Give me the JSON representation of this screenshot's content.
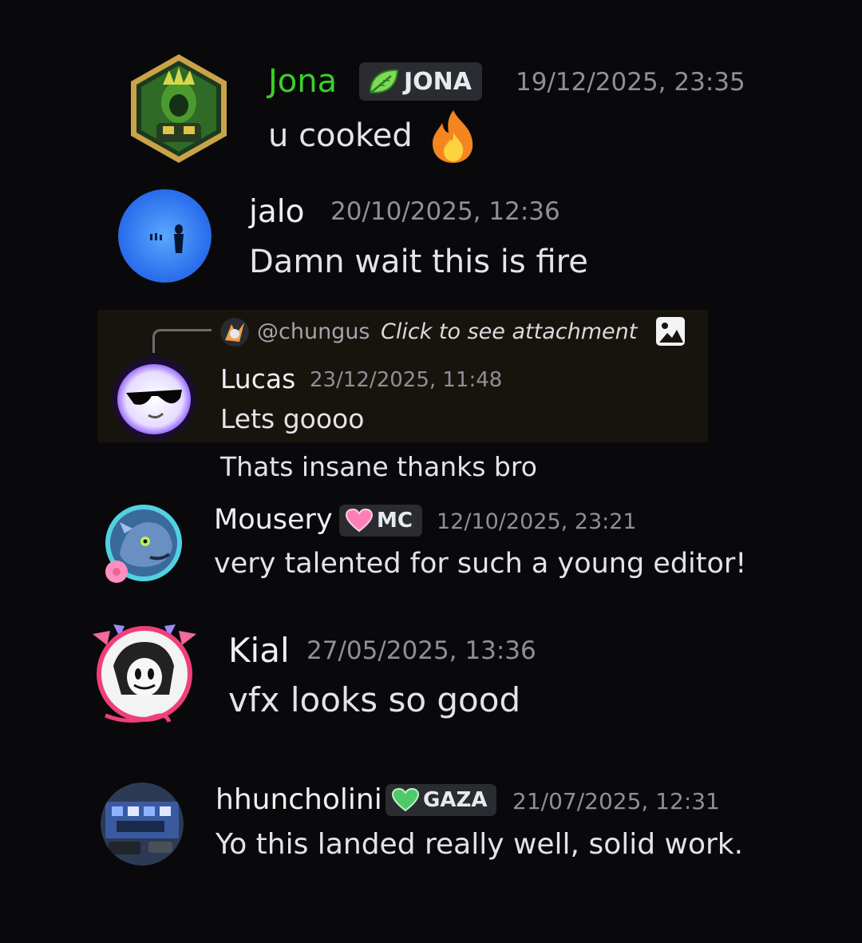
{
  "colors": {
    "background": "#09090b",
    "highlight": "#17140e",
    "username_green": "#3ccf2a",
    "timestamp": "#8e9096",
    "tag_bg": "#2b2c31"
  },
  "messages": [
    {
      "username": "Jona",
      "tag": {
        "label": "JONA",
        "icon": "leaf-icon"
      },
      "timestamp": "19/12/2025, 23:35",
      "text": "u cooked",
      "emoji": "fire-emoji"
    },
    {
      "username": "jalo",
      "timestamp": "20/10/2025, 12:36",
      "text": "Damn wait this is fire"
    },
    {
      "reply": {
        "mention": "@chungus",
        "preview": "Click to see attachment",
        "icon": "image-icon"
      },
      "username": "Lucas",
      "timestamp": "23/12/2025, 11:48",
      "text": "Lets goooo",
      "followup": "Thats insane thanks bro"
    },
    {
      "username": "Mousery",
      "tag": {
        "label": "MC",
        "icon": "pink-heart-icon"
      },
      "timestamp": "12/10/2025, 23:21",
      "text": "very talented for such a young editor!"
    },
    {
      "username": "Kial",
      "timestamp": "27/05/2025, 13:36",
      "text": "vfx looks so good"
    },
    {
      "username": "hhuncholini",
      "tag": {
        "label": "GAZA",
        "icon": "green-heart-icon"
      },
      "timestamp": "21/07/2025, 12:31",
      "text": "Yo this landed really well, solid work."
    }
  ]
}
